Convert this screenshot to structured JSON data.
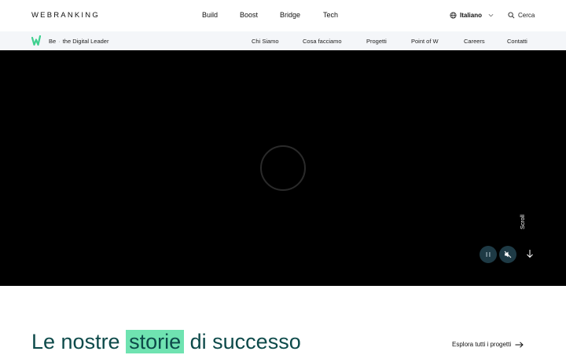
{
  "header": {
    "logo": "WEBRANKING",
    "nav": [
      "Build",
      "Boost",
      "Bridge",
      "Tech"
    ],
    "language": "Italiano",
    "search_label": "Cerca"
  },
  "subheader": {
    "tagline_prefix": "Be",
    "tagline_sep": "·",
    "tagline_rest": "the Digital Leader",
    "nav": [
      "Chi Siamo",
      "Cosa facciamo",
      "Progetti",
      "Point of W",
      "Careers",
      "Contatti"
    ]
  },
  "hero": {
    "scroll_label": "Scroll",
    "pause_icon": "pause-icon",
    "mute_icon": "mute-icon"
  },
  "section": {
    "title_before": "Le nostre",
    "title_highlight": "storie",
    "title_after": "di successo",
    "explore_link": "Esplora tutti i progetti"
  },
  "colors": {
    "accent": "#6fe3b1",
    "headline": "#0d4a4a",
    "hero_bg": "#000000",
    "control_bg": "#1e3a45"
  }
}
